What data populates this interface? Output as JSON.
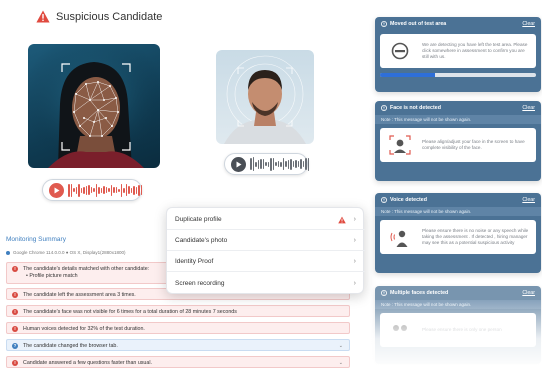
{
  "header": {
    "title": "Suspicious Candidate",
    "icon": "warning-triangle-icon",
    "icon_color": "#e04a3f"
  },
  "photos": {
    "left": {
      "icon": "face-mesh-scan-photo"
    },
    "right": {
      "icon": "candidate-face-scan-photo"
    }
  },
  "audio": {
    "left": {
      "icon": "play-icon",
      "accent": "#e05a4f"
    },
    "right": {
      "icon": "play-icon",
      "accent": "#4a4f56"
    }
  },
  "monitoring": {
    "title": "Monitoring Summary",
    "browser": "Google Chrome 114.0.0.0 ● OS X, Display1(2880x1800)",
    "rows": [
      {
        "text": "The candidate's details matched with other candidate:",
        "sub": "• Profile picture match",
        "type": "red"
      },
      {
        "text": "The candidate left the assessment area 3 times.",
        "type": "red"
      },
      {
        "text": "The candidate's face was not visible for 6 times for a total duration of 28 minutes 7 seconds",
        "type": "red"
      },
      {
        "text": "Human voices detected for 32% of the test duration.",
        "type": "red"
      },
      {
        "text": "The candidate changed the browser tab.",
        "type": "blue"
      },
      {
        "text": "Candidate answered a few questions faster than usual.",
        "type": "red"
      }
    ]
  },
  "menu": {
    "items": [
      {
        "label": "Duplicate profile",
        "warning": true
      },
      {
        "label": "Candidate's photo"
      },
      {
        "label": "Identity Proof"
      },
      {
        "label": "Screen recording"
      }
    ]
  },
  "cards": [
    {
      "title": "Moved out of test area",
      "clear": "Clear",
      "message": "We are detecting you have left the test area. Please click somewhere in assessment to confirm you are still with us.",
      "icon": "no-entry-icon",
      "progress": 0.35
    },
    {
      "title": "Face is not detected",
      "clear": "Clear",
      "note": "Note : This message will not be shown again.",
      "message": "Please align/adjust your face in the screen to have complete visibility of the face.",
      "icon": "face-frame-icon"
    },
    {
      "title": "Voice detected",
      "clear": "Clear",
      "note": "Note : This message will not be shown again.",
      "message": "Please ensure there is no noise or any speech while taking the assessment . If detected , hiring manager may see this as a potential suspicious activity",
      "icon": "person-voice-icon"
    },
    {
      "title": "Multiple faces detected",
      "clear": "Clear",
      "note": "Note : This message will not be shown again.",
      "message": "Please ensure there is only one person",
      "icon": "multiple-faces-icon"
    }
  ],
  "colors": {
    "card_bg": "#4b7295",
    "alert_red": "#d84a41",
    "link_blue": "#3f7fbf"
  }
}
